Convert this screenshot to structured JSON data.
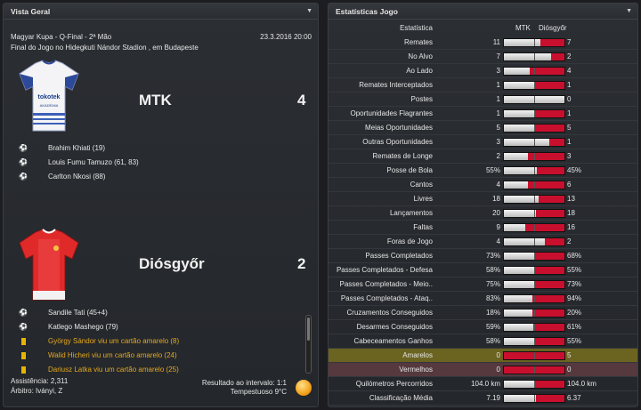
{
  "left": {
    "title": "Vista Geral",
    "competition": "Magyar Kupa - Q-Final - 2ª Mão",
    "datetime": "23.3.2016 20:00",
    "venue": "Final do Jogo no Hidegkuti Nándor Stadion , em Budapeste",
    "home": {
      "name": "MTK",
      "score": "4",
      "events": [
        {
          "icon": "goal-icon",
          "text": "Brahim Khiati (19)"
        },
        {
          "icon": "goal-icon",
          "text": "Louis Fumu Tamuzo (61, 83)"
        },
        {
          "icon": "goal-icon",
          "text": "Carlton Nkosi (88)"
        }
      ]
    },
    "away": {
      "name": "Diósgyőr",
      "score": "2",
      "events": [
        {
          "icon": "goal-icon",
          "type": "goal",
          "text": "Sandile Tati (45+4)"
        },
        {
          "icon": "goal-icon",
          "type": "goal",
          "text": "Katlego Mashego (79)"
        },
        {
          "icon": "yellow-card-icon",
          "type": "yellow",
          "text": "György Sándor viu um cartão amarelo (8)"
        },
        {
          "icon": "yellow-card-icon",
          "type": "yellow",
          "text": "Walid Hicheri viu um cartão amarelo (24)"
        },
        {
          "icon": "yellow-card-icon",
          "type": "yellow",
          "text": "Dariusz Latka viu um cartão amarelo (25)"
        }
      ]
    },
    "attendance": "Assistência: 2,311",
    "referee": "Árbitro: Iványi, Z",
    "halftime": "Resultado ao intervalo: 1:1",
    "weather": "Tempestuoso 9°C",
    "kit_home_text": "tokotek",
    "kit_home_subtext": "AKADÉMIA"
  },
  "right": {
    "title": "Estatísticas Jogo",
    "col_stat": "Estatística",
    "col_home": "MTK",
    "col_away": "Diósgyőr",
    "rows": [
      {
        "label": "Remates",
        "home": "11",
        "away": "7",
        "frac": 0.61
      },
      {
        "label": "No Alvo",
        "home": "7",
        "away": "2",
        "frac": 0.78
      },
      {
        "label": "Ao Lado",
        "home": "3",
        "away": "4",
        "frac": 0.43
      },
      {
        "label": "Remates Interceptados",
        "home": "1",
        "away": "1",
        "frac": 0.5
      },
      {
        "label": "Postes",
        "home": "1",
        "away": "0",
        "frac": 1.0
      },
      {
        "label": "Oportunidades Flagrantes",
        "home": "1",
        "away": "1",
        "frac": 0.5
      },
      {
        "label": "Meias Oportunidades",
        "home": "5",
        "away": "5",
        "frac": 0.5
      },
      {
        "label": "Outras Oportunidades",
        "home": "3",
        "away": "1",
        "frac": 0.75
      },
      {
        "label": "Remates de Longe",
        "home": "2",
        "away": "3",
        "frac": 0.4
      },
      {
        "label": "Posse de Bola",
        "home": "55%",
        "away": "45%",
        "frac": 0.55
      },
      {
        "label": "Cantos",
        "home": "4",
        "away": "6",
        "frac": 0.4
      },
      {
        "label": "Livres",
        "home": "18",
        "away": "13",
        "frac": 0.58
      },
      {
        "label": "Lançamentos",
        "home": "20",
        "away": "18",
        "frac": 0.53
      },
      {
        "label": "Faltas",
        "home": "9",
        "away": "16",
        "frac": 0.36
      },
      {
        "label": "Foras de Jogo",
        "home": "4",
        "away": "2",
        "frac": 0.67
      },
      {
        "label": "Passes Completados",
        "home": "73%",
        "away": "68%",
        "frac": 0.52
      },
      {
        "label": "Passes Completados - Defesa",
        "home": "58%",
        "away": "55%",
        "frac": 0.51
      },
      {
        "label": "Passes Completados - Meio..",
        "home": "75%",
        "away": "73%",
        "frac": 0.51
      },
      {
        "label": "Passes Completados - Ataq..",
        "home": "83%",
        "away": "94%",
        "frac": 0.47
      },
      {
        "label": "Cruzamentos Conseguidos",
        "home": "18%",
        "away": "20%",
        "frac": 0.47
      },
      {
        "label": "Desarmes Conseguidos",
        "home": "59%",
        "away": "61%",
        "frac": 0.49
      },
      {
        "label": "Cabeceamentos Ganhos",
        "home": "58%",
        "away": "55%",
        "frac": 0.51
      },
      {
        "label": "Amarelos",
        "home": "0",
        "away": "5",
        "frac": 0.0,
        "highlight": "yellow"
      },
      {
        "label": "Vermelhos",
        "home": "0",
        "away": "0",
        "frac": 0.0,
        "highlight": "red"
      },
      {
        "label": "Quilómetros Percorridos",
        "home": "104.0 km",
        "away": "104.0 km",
        "frac": 0.5
      },
      {
        "label": "Classificação Média",
        "home": "7.19",
        "away": "6.37",
        "frac": 0.53
      }
    ]
  },
  "colors": {
    "home_bar": "#e0e0e0",
    "away_bar": "#c8102e",
    "yellow_text": "#e5a81e",
    "highlight_yellow": "#6b6320",
    "highlight_red": "#55393e"
  }
}
